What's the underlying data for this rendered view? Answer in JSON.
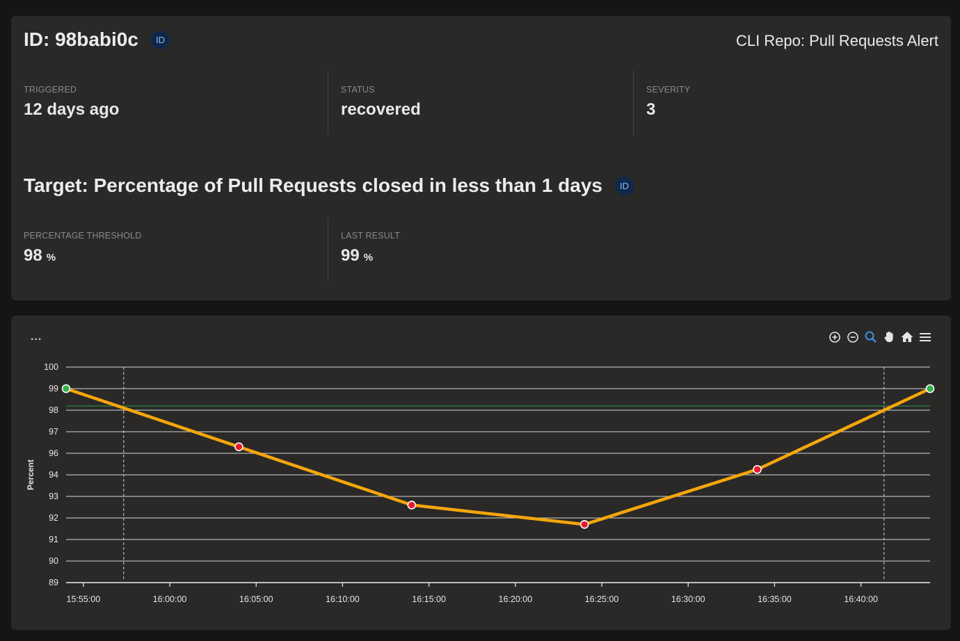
{
  "alert": {
    "id_text": "ID: 98babi0c",
    "id_badge": "ID",
    "name": "CLI Repo: Pull Requests Alert"
  },
  "stats": {
    "triggered_label": "TRIGGERED",
    "triggered_value": "12 days ago",
    "status_label": "STATUS",
    "status_value": "recovered",
    "severity_label": "SEVERITY",
    "severity_value": "3"
  },
  "target": {
    "title": "Target: Percentage of Pull Requests closed in less than 1 days",
    "id_badge": "ID",
    "threshold_label": "PERCENTAGE THRESHOLD",
    "threshold_value": "98",
    "threshold_unit": "%",
    "last_result_label": "LAST RESULT",
    "last_result_value": "99",
    "last_result_unit": "%"
  },
  "chart_menu": "...",
  "toolbar": [
    "zoom-in-icon",
    "zoom-out-icon",
    "selection-zoom-icon",
    "pan-icon",
    "reset-home-icon",
    "menu-icon"
  ],
  "colors": {
    "line": "#f5a60c",
    "point_ok": "#37b24d",
    "point_bad": "#e8192c",
    "threshold": "#2f9e44"
  },
  "chart_data": {
    "type": "line",
    "title": "",
    "xlabel": "",
    "ylabel": "Percent",
    "x_ticks": [
      "15:55:00",
      "16:00:00",
      "16:05:00",
      "16:10:00",
      "16:15:00",
      "16:20:00",
      "16:25:00",
      "16:30:00",
      "16:35:00",
      "16:40:00"
    ],
    "y_ticks": [
      "100",
      "99",
      "98",
      "97",
      "96",
      "94",
      "93",
      "92",
      "91",
      "90",
      "89"
    ],
    "x_range": [
      "15:54:00",
      "16:44:00"
    ],
    "threshold": 98,
    "annotations_x": [
      "15:57:20",
      "16:41:20"
    ],
    "grid": true,
    "series": [
      {
        "x": [
          "15:54:00",
          "16:04:00",
          "16:14:00",
          "16:24:00",
          "16:34:00",
          "16:44:00"
        ],
        "y": [
          99.0,
          96.3,
          92.6,
          91.7,
          94.5,
          99.0
        ]
      }
    ]
  }
}
